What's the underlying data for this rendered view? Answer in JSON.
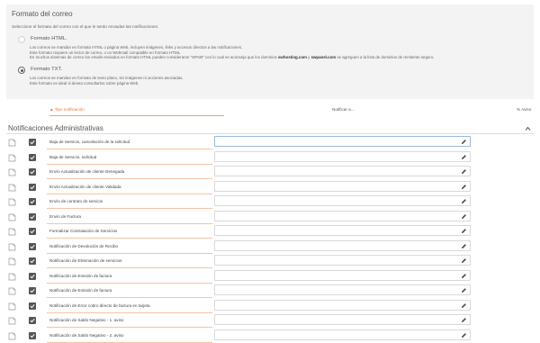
{
  "format_section": {
    "title": "Formato del correo",
    "subtitle": "Seleccione el formato del correo con el que le serán enviadas las notificaciones.",
    "options": [
      {
        "label": "Formato HTML.",
        "selected": false,
        "desc_lines": [
          "Los correos se mandan en formato HTML o página Web, incluyen imágenes, links y accesos directos a las notificaciones.",
          "Este formato requiere un lector de correo, o un Webmail compatible en formato HTML.",
          "En muchos sistemas de correo los emails enviados en formato HTML pueden considerarse \"SPAM\" con lo cual se aconseja que los dominios ",
          "swhosting.com",
          " y ",
          "swpanel.com",
          " se agreguen a la lista de dominios de remitente seguro."
        ]
      },
      {
        "label": "Formato TXT.",
        "selected": true,
        "desc_lines": [
          "Los correos se mandan en formato de texto plano, sin imágenes ni acciones asociadas.",
          "Este formato es ideal si desea consultarlos sobre página Web."
        ]
      }
    ]
  },
  "tabs": [
    {
      "label": "▲ Tipo notificación",
      "active": true
    },
    {
      "label": "Notificar a...",
      "active": false
    },
    {
      "label": "% Aviso",
      "active": false
    }
  ],
  "admin_section": {
    "title": "Notificaciones Administrativas",
    "rows": [
      {
        "label": "Baja de Servicio, cancelación de la solicitud",
        "value": ""
      },
      {
        "label": "Baja de Servicio, solicitud",
        "value": ""
      },
      {
        "label": "Envío Actualización de cliente Denegada",
        "value": ""
      },
      {
        "label": "Envío Actualización de cliente Validada",
        "value": ""
      },
      {
        "label": "Envío de contrato de servicio",
        "value": ""
      },
      {
        "label": "Envío de Factura",
        "value": ""
      },
      {
        "label": "Formalizar Contratación de Servicios",
        "value": ""
      },
      {
        "label": "Notificación de Devolución de Recibo",
        "value": ""
      },
      {
        "label": "Notificación de Eliminación de servicios",
        "value": ""
      },
      {
        "label": "Notificación de Emisión de factura",
        "value": ""
      },
      {
        "label": "Notificación de Emisión de factura",
        "value": ""
      },
      {
        "label": "Notificación de Error cobro directo de factura en tarjeta",
        "value": ""
      },
      {
        "label": "Notificación de Saldo Negativo - 1. aviso",
        "value": ""
      },
      {
        "label": "Notificación de Saldo Negativo - 2. aviso",
        "value": ""
      }
    ]
  },
  "colors": {
    "accent": "#e07a40",
    "panel_bg": "#f3f3f3",
    "checkbox": "#555555"
  }
}
